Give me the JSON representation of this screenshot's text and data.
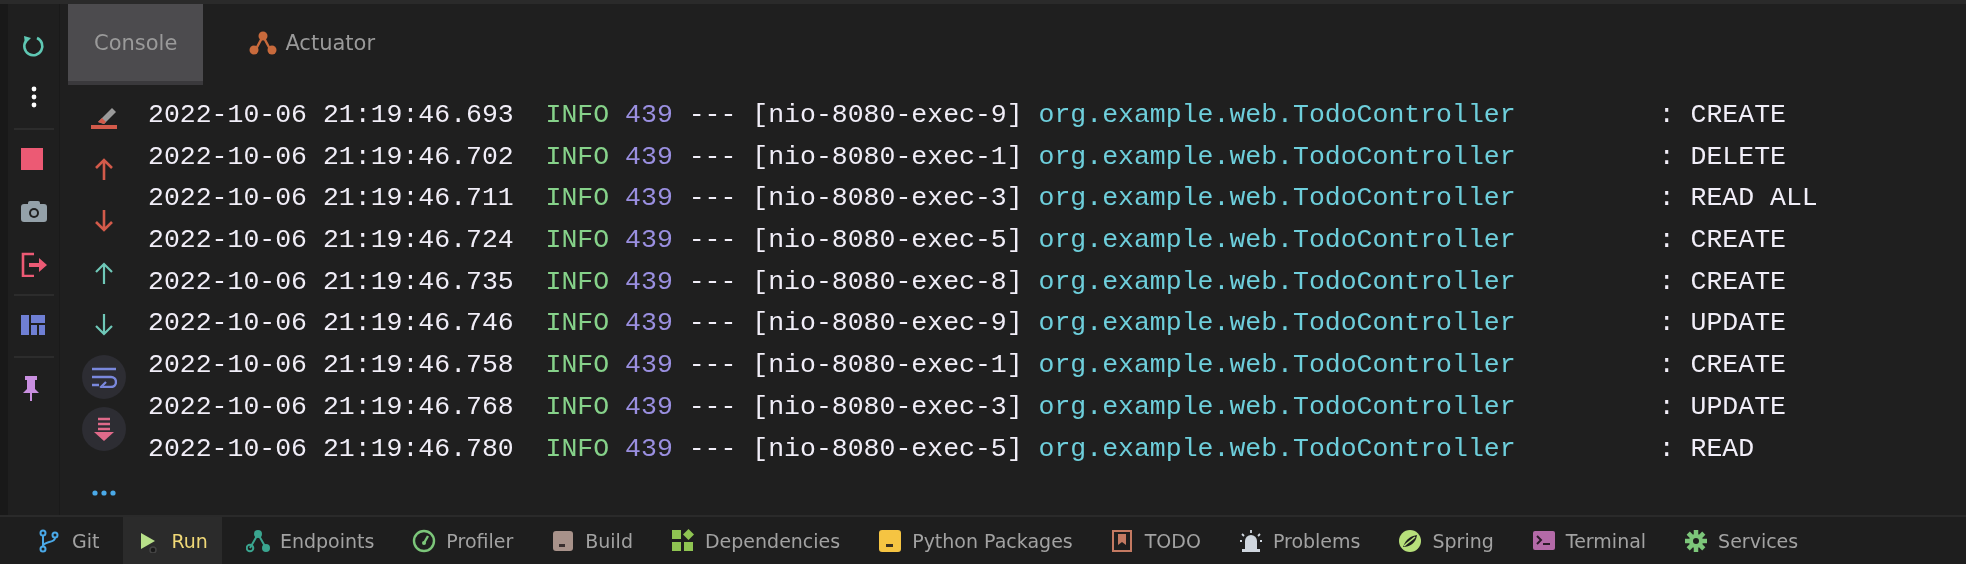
{
  "main_toolbar": [
    {
      "kind": "rerun"
    },
    {
      "kind": "more"
    },
    {
      "kind": "stop"
    },
    {
      "kind": "snapshot"
    },
    {
      "kind": "exit"
    },
    {
      "kind": "layout"
    },
    {
      "kind": "pin"
    }
  ],
  "tabs": [
    {
      "label": "Console",
      "selected": true
    },
    {
      "label": "Actuator",
      "selected": false
    }
  ],
  "console_tools": [
    {
      "kind": "clear",
      "on": false
    },
    {
      "kind": "up",
      "on": false
    },
    {
      "kind": "down",
      "on": false
    },
    {
      "kind": "up2",
      "on": false
    },
    {
      "kind": "down2",
      "on": false
    },
    {
      "kind": "wrap",
      "on": true
    },
    {
      "kind": "scroll",
      "on": true
    },
    {
      "kind": "more",
      "on": false
    }
  ],
  "log": [
    {
      "timestamp": "2022-10-06 21:19:46.693",
      "level": "INFO",
      "pid": "439",
      "separator": "---",
      "thread": "[nio-8080-exec-9]",
      "logger": "org.example.web.TodoController",
      "message": ": CREATE"
    },
    {
      "timestamp": "2022-10-06 21:19:46.702",
      "level": "INFO",
      "pid": "439",
      "separator": "---",
      "thread": "[nio-8080-exec-1]",
      "logger": "org.example.web.TodoController",
      "message": ": DELETE"
    },
    {
      "timestamp": "2022-10-06 21:19:46.711",
      "level": "INFO",
      "pid": "439",
      "separator": "---",
      "thread": "[nio-8080-exec-3]",
      "logger": "org.example.web.TodoController",
      "message": ": READ ALL"
    },
    {
      "timestamp": "2022-10-06 21:19:46.724",
      "level": "INFO",
      "pid": "439",
      "separator": "---",
      "thread": "[nio-8080-exec-5]",
      "logger": "org.example.web.TodoController",
      "message": ": CREATE"
    },
    {
      "timestamp": "2022-10-06 21:19:46.735",
      "level": "INFO",
      "pid": "439",
      "separator": "---",
      "thread": "[nio-8080-exec-8]",
      "logger": "org.example.web.TodoController",
      "message": ": CREATE"
    },
    {
      "timestamp": "2022-10-06 21:19:46.746",
      "level": "INFO",
      "pid": "439",
      "separator": "---",
      "thread": "[nio-8080-exec-9]",
      "logger": "org.example.web.TodoController",
      "message": ": UPDATE"
    },
    {
      "timestamp": "2022-10-06 21:19:46.758",
      "level": "INFO",
      "pid": "439",
      "separator": "---",
      "thread": "[nio-8080-exec-1]",
      "logger": "org.example.web.TodoController",
      "message": ": CREATE"
    },
    {
      "timestamp": "2022-10-06 21:19:46.768",
      "level": "INFO",
      "pid": "439",
      "separator": "---",
      "thread": "[nio-8080-exec-3]",
      "logger": "org.example.web.TodoController",
      "message": ": UPDATE"
    },
    {
      "timestamp": "2022-10-06 21:19:46.780",
      "level": "INFO",
      "pid": "439",
      "separator": "---",
      "thread": "[nio-8080-exec-5]",
      "logger": "org.example.web.TodoController",
      "message": ": READ"
    }
  ],
  "tool_windows": [
    {
      "kind": "git",
      "label": "Git",
      "selected": false
    },
    {
      "kind": "run",
      "label": "Run",
      "selected": true
    },
    {
      "kind": "endpoints",
      "label": "Endpoints",
      "selected": false
    },
    {
      "kind": "profiler",
      "label": "Profiler",
      "selected": false
    },
    {
      "kind": "build",
      "label": "Build",
      "selected": false
    },
    {
      "kind": "dependencies",
      "label": "Dependencies",
      "selected": false
    },
    {
      "kind": "python",
      "label": "Python Packages",
      "selected": false
    },
    {
      "kind": "todo",
      "label": "TODO",
      "selected": false
    },
    {
      "kind": "problems",
      "label": "Problems",
      "selected": false
    },
    {
      "kind": "spring",
      "label": "Spring",
      "selected": false
    },
    {
      "kind": "terminal",
      "label": "Terminal",
      "selected": false
    },
    {
      "kind": "services",
      "label": "Services",
      "selected": false
    }
  ]
}
